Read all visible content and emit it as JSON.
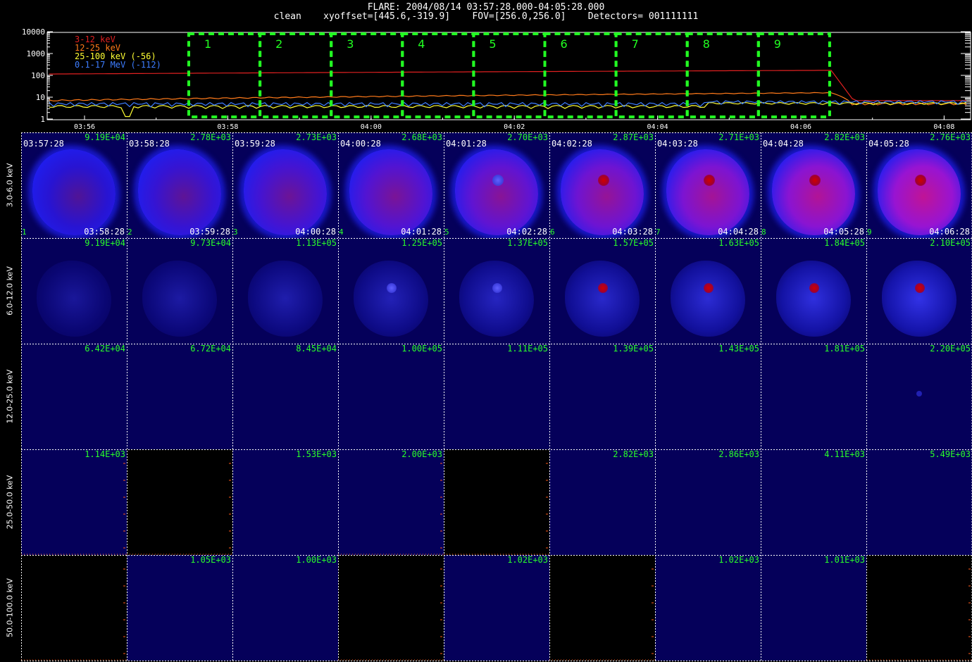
{
  "header": {
    "line1": "FLARE: 2004/08/14 03:57:28.000-04:05:28.000",
    "line2": "clean    xyoffset=[445.6,-319.9]    FOV=[256.0,256.0]    Detectors= 001111111"
  },
  "lightcurve": {
    "y_ticks": [
      "10000",
      "1000",
      "100",
      "10",
      "1"
    ],
    "x_ticks": [
      "03:56",
      "03:58",
      "04:00",
      "04:02",
      "04:04",
      "04:06",
      "04:08"
    ],
    "legend": [
      {
        "label": "3-12 keV",
        "color": "#e02020"
      },
      {
        "label": "12-25 keV",
        "color": "#ff7a1a"
      },
      {
        "label": "25-100 keV (-56)",
        "color": "#ffff33"
      },
      {
        "label": "0.1-17 MeV (-112)",
        "color": "#3d7dff"
      }
    ],
    "intervals": [
      "1",
      "2",
      "3",
      "4",
      "5",
      "6",
      "7",
      "8",
      "9"
    ],
    "interval_color": "#22ff22"
  },
  "chart_data": {
    "type": "line",
    "ylabel": "",
    "xlabel": "",
    "scale": "log",
    "ylim": [
      1,
      10000
    ],
    "x": [
      "03:56",
      "03:58",
      "04:00",
      "04:02",
      "04:04",
      "04:06",
      "04:07",
      "04:08"
    ],
    "series": [
      {
        "name": "3-12 keV",
        "values": [
          120,
          130,
          140,
          150,
          160,
          170,
          7,
          7
        ]
      },
      {
        "name": "12-25 keV",
        "values": [
          8,
          7,
          9,
          10,
          12,
          16,
          5,
          6
        ]
      },
      {
        "name": "25-100 keV (-56)",
        "values": [
          3,
          3,
          3,
          3,
          4,
          5,
          6,
          6
        ]
      },
      {
        "name": "0.1-17 MeV (-112)",
        "values": [
          4,
          4,
          3,
          4,
          4,
          5,
          6,
          7
        ]
      }
    ]
  },
  "energy_bands": [
    "3.0-6.0 keV",
    "6.0-12.0 keV",
    "12.0-25.0 keV",
    "25.0-50.0 keV",
    "50.0-100.0 keV"
  ],
  "times": {
    "start": [
      "03:57:28",
      "03:58:28",
      "03:59:28",
      "04:00:28",
      "04:01:28",
      "04:02:28",
      "04:03:28",
      "04:04:28",
      "04:05:28"
    ],
    "end": [
      "03:58:28",
      "03:59:28",
      "04:00:28",
      "04:01:28",
      "04:02:28",
      "04:03:28",
      "04:04:28",
      "04:05:28",
      "04:06:28"
    ]
  },
  "peaks": [
    [
      "9.19E+04",
      "2.78E+03",
      "2.73E+03",
      "2.68E+03",
      "2.70E+03",
      "2.87E+03",
      "2.71E+03",
      "2.82E+03",
      "2.76E+03"
    ],
    [
      "9.19E+04",
      "9.73E+04",
      "1.13E+05",
      "1.25E+05",
      "1.37E+05",
      "1.57E+05",
      "1.63E+05",
      "1.84E+05",
      "2.10E+05"
    ],
    [
      "6.42E+04",
      "6.72E+04",
      "8.45E+04",
      "1.00E+05",
      "1.11E+05",
      "1.39E+05",
      "1.43E+05",
      "1.81E+05",
      "2.20E+05"
    ],
    [
      "1.14E+03",
      "",
      "1.53E+03",
      "2.00E+03",
      "",
      "2.82E+03",
      "2.86E+03",
      "4.11E+03",
      "5.49E+03"
    ],
    [
      "",
      "1.05E+03",
      "1.00E+03",
      "",
      "1.02E+03",
      "",
      "1.02E+03",
      "1.01E+03",
      ""
    ]
  ],
  "cell_index": [
    "1",
    "2",
    "3",
    "4",
    "5",
    "6",
    "7",
    "8",
    "9"
  ]
}
